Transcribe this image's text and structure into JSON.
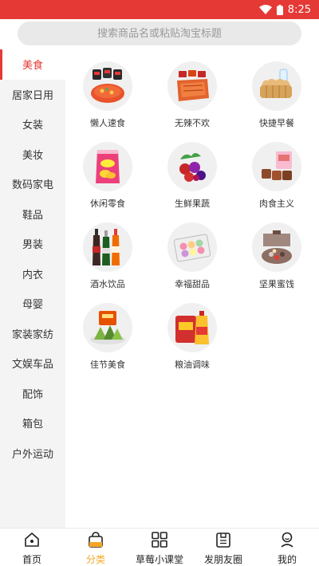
{
  "status_bar": {
    "time": "8:25",
    "wifi_icon": "wifi-icon",
    "battery_icon": "battery-icon"
  },
  "search": {
    "placeholder": "搜索商品名或粘贴淘宝标题"
  },
  "sidebar": {
    "accent_color": "#e53935",
    "items": [
      {
        "label": "美食",
        "active": true
      },
      {
        "label": "居家日用"
      },
      {
        "label": "女装"
      },
      {
        "label": "美妆"
      },
      {
        "label": "数码家电"
      },
      {
        "label": "鞋品"
      },
      {
        "label": "男装"
      },
      {
        "label": "内衣"
      },
      {
        "label": "母婴"
      },
      {
        "label": "家装家纺"
      },
      {
        "label": "文娱车品"
      },
      {
        "label": "配饰"
      },
      {
        "label": "箱包"
      },
      {
        "label": "户外运动"
      }
    ]
  },
  "categories": [
    {
      "label": "懒人速食",
      "icon": "instant-noodles-icon"
    },
    {
      "label": "无辣不欢",
      "icon": "spicy-snacks-icon"
    },
    {
      "label": "快捷早餐",
      "icon": "bread-icon"
    },
    {
      "label": "休闲零食",
      "icon": "chips-bag-icon"
    },
    {
      "label": "生鲜果蔬",
      "icon": "berries-icon"
    },
    {
      "label": "肉食主义",
      "icon": "meat-snack-icon"
    },
    {
      "label": "酒水饮品",
      "icon": "bottles-icon"
    },
    {
      "label": "幸福甜品",
      "icon": "macarons-icon"
    },
    {
      "label": "坚果蜜饯",
      "icon": "nuts-box-icon"
    },
    {
      "label": "佳节美食",
      "icon": "zongzi-icon"
    },
    {
      "label": "粮油调味",
      "icon": "rice-oil-icon"
    }
  ],
  "tabbar": {
    "active_color": "#f5a623",
    "items": [
      {
        "label": "首页",
        "icon": "home-icon"
      },
      {
        "label": "分类",
        "icon": "shopping-bag-icon",
        "active": true
      },
      {
        "label": "草莓小课堂",
        "icon": "grid-icon"
      },
      {
        "label": "发朋友圈",
        "icon": "share-card-icon"
      },
      {
        "label": "我的",
        "icon": "profile-icon"
      }
    ]
  }
}
